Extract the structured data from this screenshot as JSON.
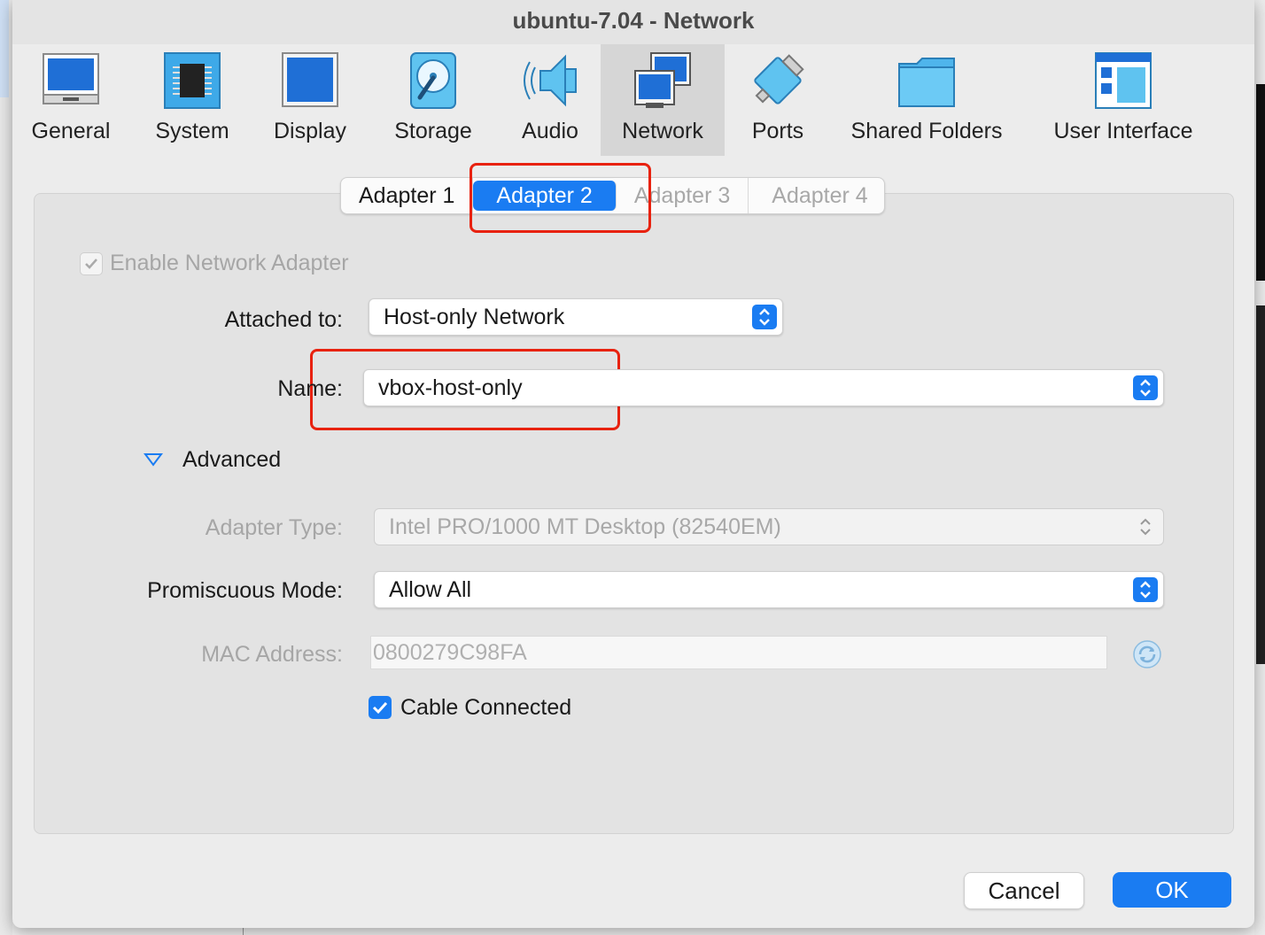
{
  "window": {
    "title": "ubuntu-7.04 - Network"
  },
  "toolbar": {
    "items": [
      {
        "label": "General",
        "icon": "general-icon"
      },
      {
        "label": "System",
        "icon": "chip-icon"
      },
      {
        "label": "Display",
        "icon": "monitor-icon"
      },
      {
        "label": "Storage",
        "icon": "disk-icon"
      },
      {
        "label": "Audio",
        "icon": "speaker-icon"
      },
      {
        "label": "Network",
        "icon": "network-icon",
        "selected": true
      },
      {
        "label": "Ports",
        "icon": "plug-icon"
      },
      {
        "label": "Shared Folders",
        "icon": "folder-icon"
      },
      {
        "label": "User Interface",
        "icon": "window-layout-icon"
      }
    ]
  },
  "tabs": [
    {
      "label": "Adapter 1",
      "state": "normal"
    },
    {
      "label": "Adapter 2",
      "state": "active"
    },
    {
      "label": "Adapter 3",
      "state": "disabled"
    },
    {
      "label": "Adapter 4",
      "state": "disabled"
    }
  ],
  "form": {
    "enable_adapter": {
      "label": "Enable Network Adapter",
      "checked": true
    },
    "attached_to": {
      "label": "Attached to:",
      "value": "Host-only Network"
    },
    "name": {
      "label": "Name:",
      "value": "vbox-host-only"
    },
    "advanced": {
      "label": "Advanced"
    },
    "adapter_type": {
      "label": "Adapter Type:",
      "value": "Intel PRO/1000 MT Desktop (82540EM)"
    },
    "promiscuous_mode": {
      "label": "Promiscuous Mode:",
      "value": "Allow All"
    },
    "mac_address": {
      "label": "MAC Address:",
      "value": "0800279C98FA"
    },
    "cable_connected": {
      "label": "Cable Connected",
      "checked": true
    }
  },
  "buttons": {
    "cancel": "Cancel",
    "ok": "OK"
  },
  "colors": {
    "accent": "#1a7cf2",
    "highlight_box": "#e8220f"
  }
}
